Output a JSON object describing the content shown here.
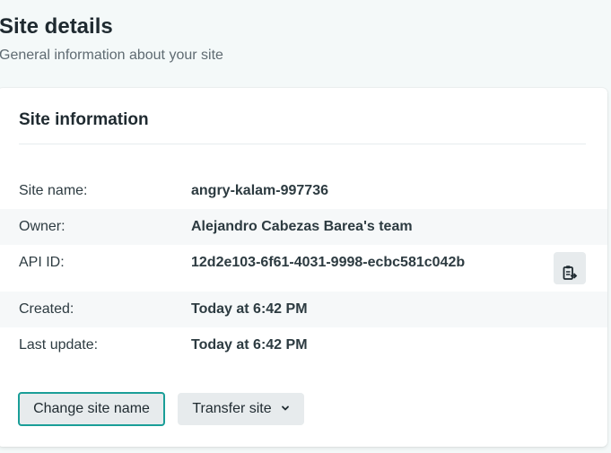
{
  "header": {
    "title": "Site details",
    "subtitle": "General information about your site"
  },
  "card": {
    "title": "Site information",
    "rows": [
      {
        "label": "Site name:",
        "value": "angry-kalam-997736"
      },
      {
        "label": "Owner:",
        "value": "Alejandro Cabezas Barea's team"
      },
      {
        "label": "API ID:",
        "value": "12d2e103-6f61-4031-9998-ecbc581c042b"
      },
      {
        "label": "Created:",
        "value": "Today at 6:42 PM"
      },
      {
        "label": "Last update:",
        "value": "Today at 6:42 PM"
      }
    ],
    "copy_icon": "clipboard-copy-icon"
  },
  "actions": {
    "change_name_label": "Change site name",
    "transfer_label": "Transfer site",
    "transfer_icon": "chevron-down-icon"
  },
  "colors": {
    "accent": "#1a9e98",
    "button_bg": "#e7ebed",
    "page_bg": "#f4f9f9"
  }
}
